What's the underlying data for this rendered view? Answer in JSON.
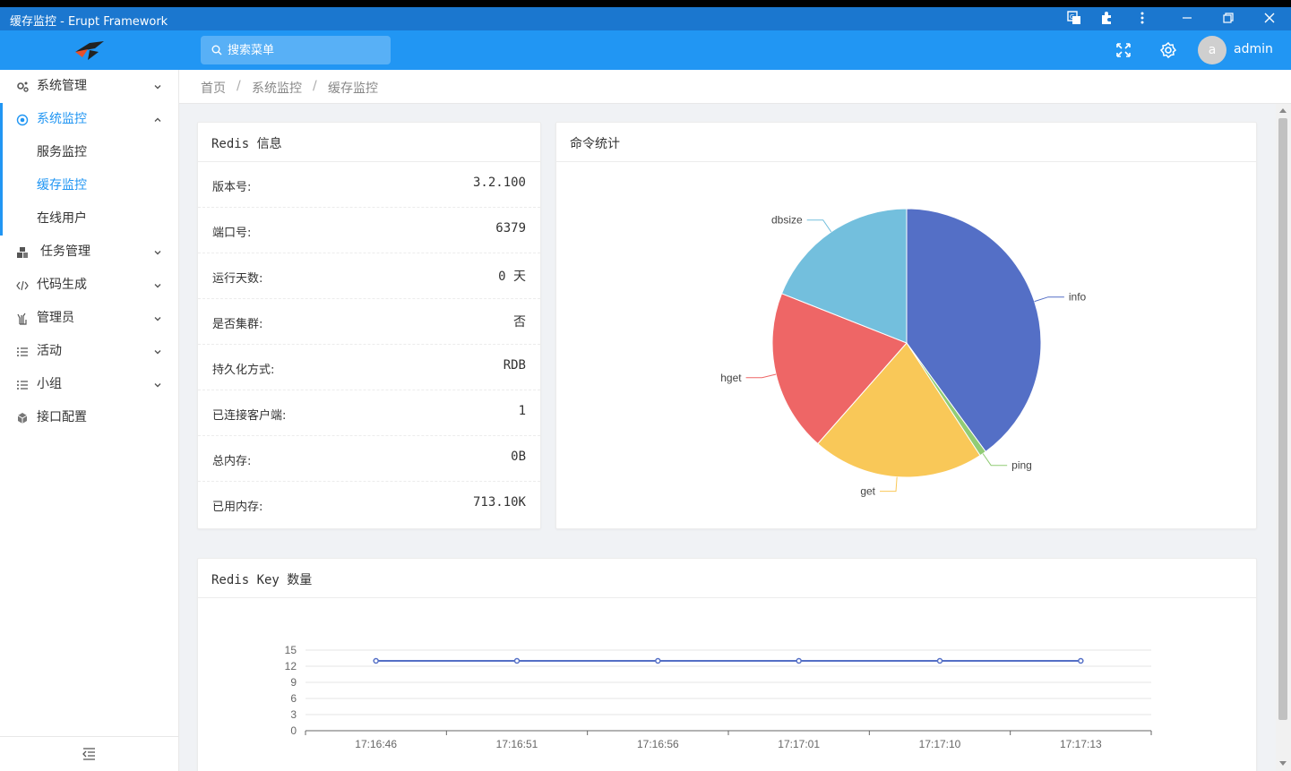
{
  "window": {
    "title": "缓存监控 - Erupt Framework",
    "icons": [
      "translate-icon",
      "extensions-icon",
      "more-vert-icon",
      "minimize-icon",
      "restore-icon",
      "close-icon"
    ]
  },
  "header": {
    "search_placeholder": "搜索菜单",
    "username": "admin",
    "avatar_letter": "a"
  },
  "sidebar": {
    "items": [
      {
        "label": "系统管理",
        "icon": "gears-icon"
      },
      {
        "label": "系统监控",
        "icon": "radar-icon"
      },
      {
        "label": "任务管理",
        "icon": "cubes-icon"
      },
      {
        "label": "代码生成",
        "icon": "code-icon"
      },
      {
        "label": "管理员",
        "icon": "hand-icon"
      },
      {
        "label": "活动",
        "icon": "list-icon"
      },
      {
        "label": "小组",
        "icon": "list-icon"
      },
      {
        "label": "接口配置",
        "icon": "cube-icon"
      }
    ],
    "submenu": [
      "服务监控",
      "缓存监控",
      "在线用户"
    ]
  },
  "breadcrumb": [
    "首页",
    "系统监控",
    "缓存监控"
  ],
  "redis_info": {
    "title": "Redis 信息",
    "rows": [
      {
        "k": "版本号:",
        "v": "3.2.100"
      },
      {
        "k": "端口号:",
        "v": "6379"
      },
      {
        "k": "运行天数:",
        "v": "0 天"
      },
      {
        "k": "是否集群:",
        "v": "否"
      },
      {
        "k": "持久化方式:",
        "v": "RDB"
      },
      {
        "k": "已连接客户端:",
        "v": "1"
      },
      {
        "k": "总内存:",
        "v": "0B"
      },
      {
        "k": "已用内存:",
        "v": "713.10K"
      }
    ]
  },
  "command_stats": {
    "title": "命令统计"
  },
  "key_count": {
    "title": "Redis Key 数量"
  },
  "colors": {
    "primary": "#2196f3",
    "titlebar": "#1b77cf"
  },
  "chart_data": [
    {
      "type": "pie",
      "categories": [
        "info",
        "ping",
        "get",
        "hget",
        "dbsize"
      ],
      "values": [
        40,
        0.8,
        20.7,
        19.5,
        19
      ],
      "colors": [
        "#546fc6",
        "#91cc75",
        "#f9c858",
        "#ee6666",
        "#73bfdd"
      ]
    },
    {
      "type": "line",
      "x": [
        "17:16:46",
        "17:16:51",
        "17:16:56",
        "17:17:01",
        "17:17:10",
        "17:17:13"
      ],
      "y": [
        13,
        13,
        13,
        13,
        13,
        13
      ],
      "ylim": [
        0,
        15
      ],
      "yticks": [
        "0",
        "3",
        "6",
        "9",
        "12",
        "15"
      ],
      "color": "#546fc6"
    }
  ]
}
